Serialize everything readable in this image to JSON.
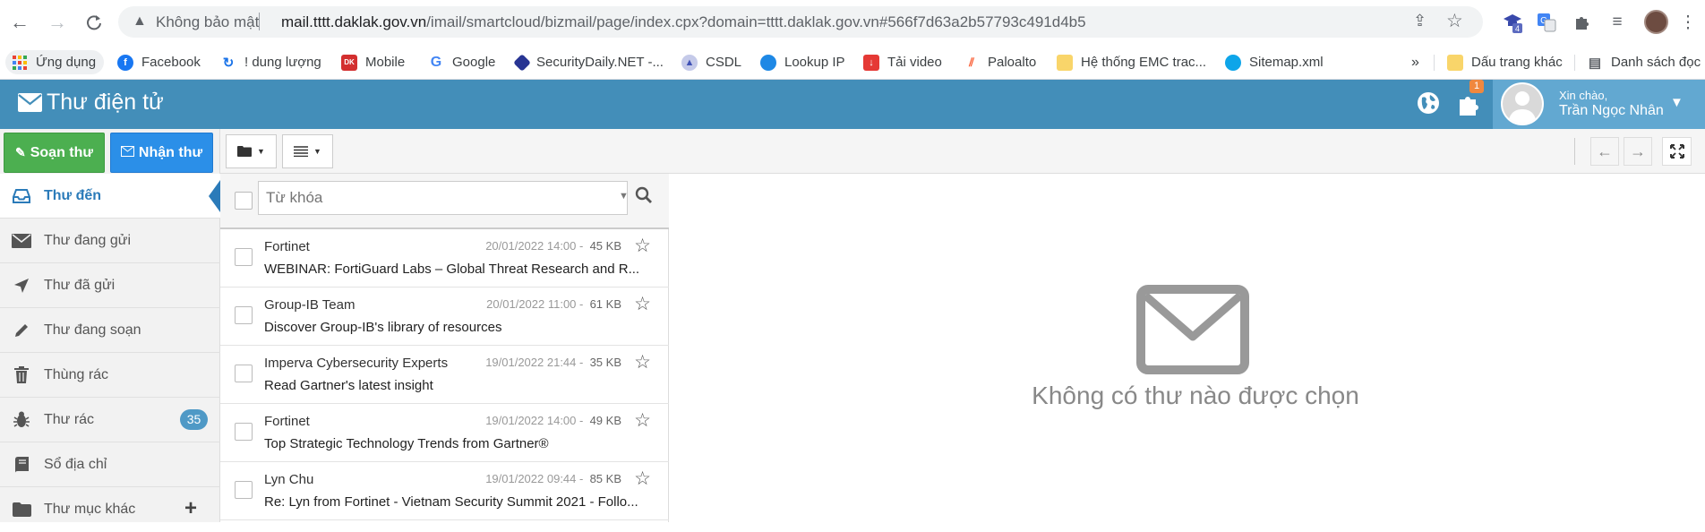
{
  "browser": {
    "insecure_label": "Không bảo mật",
    "url_host": "mail.tttt.daklak.gov.vn",
    "url_path": "/imail/smartcloud/bizmail/page/index.cpx?domain=tttt.daklak.gov.vn#566f7d63a2b57793c491d4b5",
    "extension_badge": "4"
  },
  "bookmarks": [
    {
      "label": "Ứng dụng",
      "icon": "apps-grid-icon",
      "color": "#ea4335"
    },
    {
      "label": "Facebook",
      "icon": "facebook-icon",
      "color": "#1877f2"
    },
    {
      "label": "! dung lượng",
      "icon": "refresh-icon",
      "color": "#1a73e8"
    },
    {
      "label": "Mobile",
      "icon": "mobile-icon",
      "color": "#d32f2f"
    },
    {
      "label": "Google",
      "icon": "google-icon",
      "color": "#4285f4"
    },
    {
      "label": "SecurityDaily.NET -...",
      "icon": "securitydaily-icon",
      "color": "#283593"
    },
    {
      "label": "CSDL",
      "icon": "csdl-icon",
      "color": "#3f51b5"
    },
    {
      "label": "Lookup IP",
      "icon": "globe-icon",
      "color": "#1e88e5"
    },
    {
      "label": "Tải video",
      "icon": "download-icon",
      "color": "#e53935"
    },
    {
      "label": "Paloalto",
      "icon": "paloalto-icon",
      "color": "#fa582d"
    },
    {
      "label": "Hệ thống EMC trac...",
      "icon": "folder-icon",
      "color": "#f9d56a"
    },
    {
      "label": "Sitemap.xml",
      "icon": "sitemap-icon",
      "color": "#0ea5e9"
    }
  ],
  "bookmarks_right": {
    "more": "»",
    "other": "Dấu trang khác",
    "reading": "Danh sách đọc"
  },
  "app": {
    "title": "Thư điện tử",
    "notif_count": "1",
    "greeting": "Xin chào,",
    "user_name": "Trần Ngọc Nhân"
  },
  "actions": {
    "compose": "Soạn thư",
    "receive": "Nhận thư"
  },
  "nav": [
    {
      "label": "Thư đến",
      "icon": "inbox-icon",
      "active": true
    },
    {
      "label": "Thư đang gửi",
      "icon": "envelope-icon"
    },
    {
      "label": "Thư đã gửi",
      "icon": "send-arrow-icon"
    },
    {
      "label": "Thư đang soạn",
      "icon": "pencil-icon"
    },
    {
      "label": "Thùng rác",
      "icon": "trash-icon"
    },
    {
      "label": "Thư rác",
      "icon": "bug-icon",
      "badge": "35"
    },
    {
      "label": "Sổ địa chỉ",
      "icon": "address-book-icon"
    },
    {
      "label": "Thư mục khác",
      "icon": "folder-icon"
    }
  ],
  "search": {
    "placeholder": "Từ khóa"
  },
  "emails": [
    {
      "from": "Fortinet",
      "date": "20/01/2022 14:00 -",
      "size": "45 KB",
      "subject": "WEBINAR: FortiGuard Labs – Global Threat Research and R..."
    },
    {
      "from": "Group-IB Team",
      "date": "20/01/2022 11:00 -",
      "size": "61 KB",
      "subject": "Discover Group-IB's library of resources"
    },
    {
      "from": "Imperva Cybersecurity Experts",
      "date": "19/01/2022 21:44 -",
      "size": "35 KB",
      "subject": "Read Gartner's latest insight"
    },
    {
      "from": "Fortinet",
      "date": "19/01/2022 14:00 -",
      "size": "49 KB",
      "subject": "Top Strategic Technology Trends from Gartner®"
    },
    {
      "from": "Lyn Chu",
      "date": "19/01/2022 09:44 -",
      "size": "85 KB",
      "subject": "Re: Lyn from Fortinet - Vietnam Security Summit 2021 - Follo..."
    }
  ],
  "reader": {
    "empty_message": "Không có thư nào được chọn"
  },
  "colors": {
    "header": "#438eb9",
    "compose": "#4caf50",
    "receive": "#2b8fe8",
    "badge": "#4f99c6"
  }
}
